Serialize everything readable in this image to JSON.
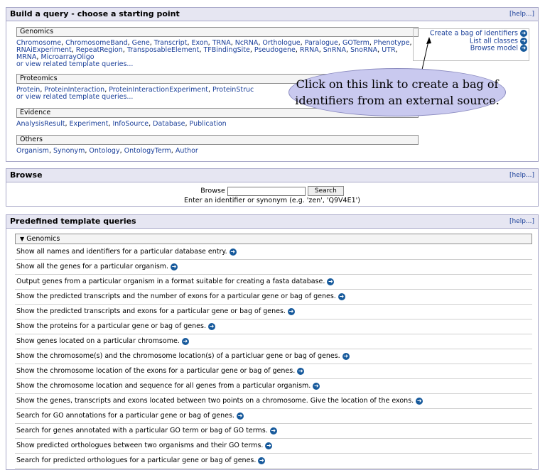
{
  "build": {
    "title": "Build a query - choose a starting point",
    "help": "[help...]",
    "sections": [
      {
        "name": "Genomics",
        "links": [
          "Chromosome",
          "ChromosomeBand",
          "Gene",
          "Transcript",
          "Exon",
          "TRNA",
          "NcRNA",
          "Orthologue",
          "Paralogue",
          "GOTerm",
          "Phenotype",
          "RNAiExperiment",
          "RepeatRegion",
          "TransposableElement",
          "TFBindingSite",
          "Pseudogene",
          "RRNA",
          "SnRNA",
          "SnoRNA",
          "UTR",
          "MRNA",
          "MicroarrayOligo"
        ],
        "templates": "or view related template queries..."
      },
      {
        "name": "Proteomics",
        "links": [
          "Protein",
          "ProteinInteraction",
          "ProteinInteractionExperiment",
          "ProteinStruc"
        ],
        "templates": "or view related template queries..."
      },
      {
        "name": "Evidence",
        "links": [
          "AnalysisResult",
          "Experiment",
          "InfoSource",
          "Database",
          "Publication"
        ],
        "templates": ""
      },
      {
        "name": "Others",
        "links": [
          "Organism",
          "Synonym",
          "Ontology",
          "OntologyTerm",
          "Author"
        ],
        "templates": ""
      }
    ],
    "right_links": [
      "Create a bag of identifiers",
      "List all classes",
      "Browse model"
    ]
  },
  "callout": "Click on this link to create a bag of identifiers from an external source.",
  "browse": {
    "title": "Browse",
    "help": "[help...]",
    "label": "Browse",
    "input_value": "",
    "button": "Search",
    "hint": "Enter an identifier or synonym (e.g. 'zen', 'Q9V4E1')"
  },
  "templates": {
    "title": "Predefined template queries",
    "help": "[help...]",
    "group": "Genomics",
    "items": [
      "Show all names and identifiers for a particular database entry.",
      "Show all the genes for a particular organism.",
      "Output genes from a particular organism in a format suitable for creating a fasta database.",
      "Show the predicted transcripts and the number of exons for a particular gene or bag of genes.",
      "Show the predicted transcripts and exons for a particular gene or bag of genes.",
      "Show the proteins for a particular gene or bag of genes.",
      "Show genes located on a particular chromsome.",
      "Show the chromosome(s) and the chromosome location(s) of a particluar gene or bag of genes.",
      "Show the chromosome location of the exons for a particular gene or bag of genes.",
      "Show the chromosome location and sequence for all genes from a particular organism.",
      "Show the genes, transcripts and exons located between two points on a chromosome. Give the location of the exons.",
      "Search for GO annotations for a particular gene or bag of genes.",
      "Search for genes annotated with a particular GO term or bag of GO terms.",
      "Show predicted orthologues between two organisms and their GO terms.",
      "Search for predicted orthologues for a particular gene or bag of genes."
    ]
  }
}
